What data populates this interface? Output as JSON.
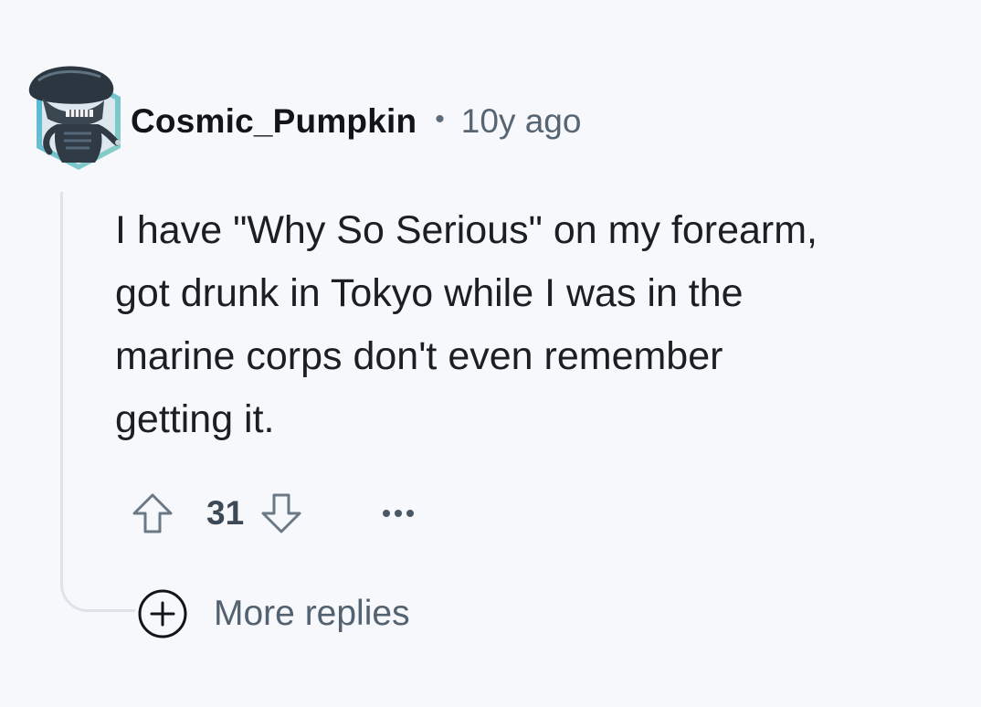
{
  "comment": {
    "username": "Cosmic_Pumpkin",
    "separator": "•",
    "timestamp": "10y ago",
    "body_lines": [
      "I have \"Why So Serious\" on my forearm,",
      "got drunk in Tokyo while I was in the",
      "marine corps don't even remember",
      "getting it."
    ],
    "score": "31",
    "more_replies_label": "More replies"
  },
  "icons": {
    "avatar": "alien-snoo-avatar-icon",
    "upvote": "upvote-arrow-icon",
    "downvote": "downvote-arrow-icon",
    "overflow": "more-options-icon",
    "expand": "plus-circle-icon"
  },
  "colors": {
    "background": "#f7f8fb",
    "username": "#11151a",
    "meta": "#566573",
    "body": "#1b1f24",
    "thread_line": "#dfe3e8",
    "avatar_border": "#3aa0c8"
  }
}
